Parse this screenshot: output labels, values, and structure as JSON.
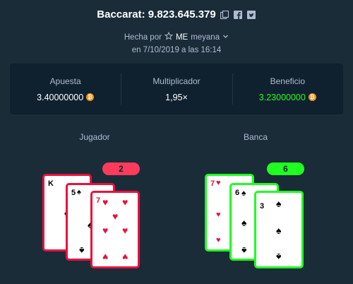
{
  "header": {
    "title": "Baccarat: 9.823.645.379",
    "made_by_prefix": "Hecha por",
    "user_prefix": "ME",
    "username": "meyana",
    "date_line": "en 7/10/2019 a las 16:14"
  },
  "stats": {
    "bet_label": "Apuesta",
    "bet_value": "3.40000000",
    "multiplier_label": "Multiplicador",
    "multiplier_value": "1,95×",
    "profit_label": "Beneficio",
    "profit_value": "3.23000000",
    "coin_symbol": "₿",
    "profit_color": "#1fff20"
  },
  "player": {
    "label": "Jugador",
    "score": "2",
    "accent": "#ff3b5c",
    "cards": [
      {
        "rank": "K",
        "suit": "♠"
      },
      {
        "rank": "5",
        "suit": "♠"
      },
      {
        "rank": "7",
        "suit": "♥"
      }
    ]
  },
  "banker": {
    "label": "Banca",
    "score": "6",
    "accent": "#1fff20",
    "cards": [
      {
        "rank": "7",
        "suit": "♥"
      },
      {
        "rank": "6",
        "suit": "♠"
      },
      {
        "rank": "3",
        "suit": "♠"
      }
    ]
  },
  "icons": {
    "copy": "copy-icon",
    "facebook": "facebook-icon",
    "twitter": "twitter-icon",
    "star": "star-icon",
    "chevron": "chevron-down-icon",
    "coin": "bitcoin-icon"
  }
}
